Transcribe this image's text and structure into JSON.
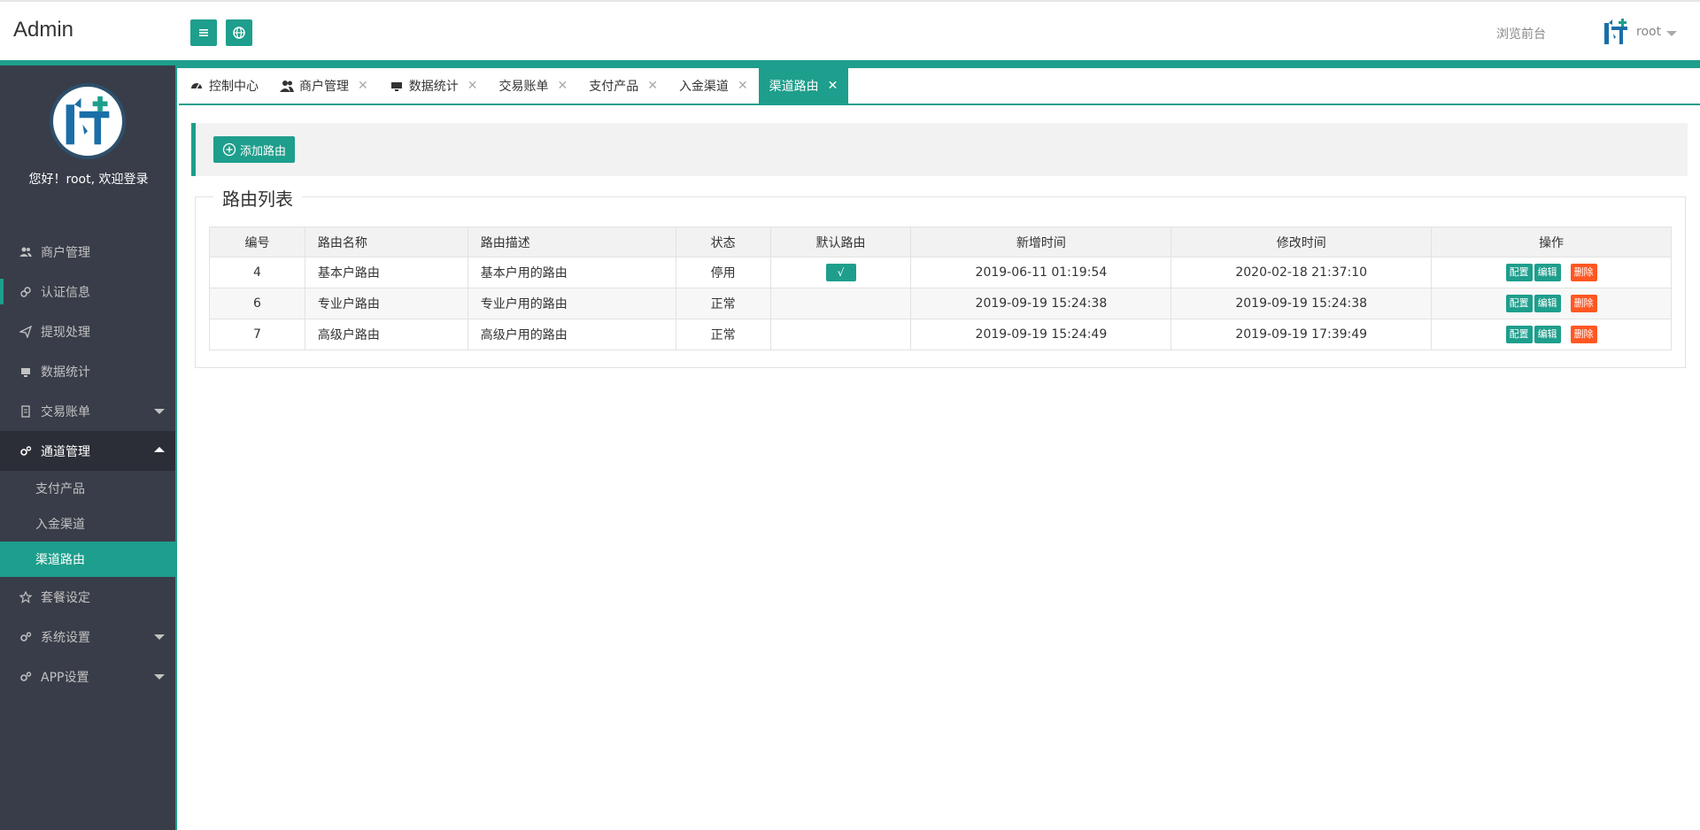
{
  "header": {
    "brand": "Admin",
    "front_link": "浏览前台",
    "username": "root"
  },
  "sidebar": {
    "welcome": "您好！root, 欢迎登录",
    "items": [
      {
        "label": "商户管理"
      },
      {
        "label": "认证信息"
      },
      {
        "label": "提现处理"
      },
      {
        "label": "数据统计"
      },
      {
        "label": "交易账单"
      },
      {
        "label": "通道管理"
      },
      {
        "label": "支付产品"
      },
      {
        "label": "入金渠道"
      },
      {
        "label": "渠道路由"
      },
      {
        "label": "套餐设定"
      },
      {
        "label": "系统设置"
      },
      {
        "label": "APP设置"
      }
    ]
  },
  "tabs": [
    {
      "label": "控制中心"
    },
    {
      "label": "商户管理"
    },
    {
      "label": "数据统计"
    },
    {
      "label": "交易账单"
    },
    {
      "label": "支付产品"
    },
    {
      "label": "入金渠道"
    },
    {
      "label": "渠道路由"
    }
  ],
  "toolbar": {
    "add_label": "添加路由"
  },
  "list": {
    "title": "路由列表",
    "headers": [
      "编号",
      "路由名称",
      "路由描述",
      "状态",
      "默认路由",
      "新增时间",
      "修改时间",
      "操作"
    ],
    "rows": [
      {
        "id": "4",
        "name": "基本户路由",
        "desc": "基本户用的路由",
        "status": "停用",
        "default": "√",
        "created": "2019-06-11 01:19:54",
        "modified": "2020-02-18 21:37:10"
      },
      {
        "id": "6",
        "name": "专业户路由",
        "desc": "专业户用的路由",
        "status": "正常",
        "default": "",
        "created": "2019-09-19 15:24:38",
        "modified": "2019-09-19 15:24:38"
      },
      {
        "id": "7",
        "name": "高级户路由",
        "desc": "高级户用的路由",
        "status": "正常",
        "default": "",
        "created": "2019-09-19 15:24:49",
        "modified": "2019-09-19 17:39:49"
      }
    ],
    "actions": {
      "config": "配置",
      "edit": "编辑",
      "delete": "删除"
    }
  },
  "colors": {
    "accent": "#1e9e8c",
    "danger": "#ff5722",
    "sidebar": "#393d49"
  }
}
